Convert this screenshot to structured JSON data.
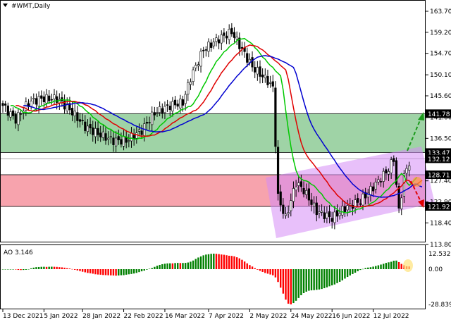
{
  "title": "#WMT,Daily",
  "indicator_label": "AO 3.146",
  "price_axis": [
    "163.70",
    "159.20",
    "154.70",
    "150.10",
    "145.60",
    "141.00",
    "136.50",
    "127.40",
    "122.90",
    "118.40",
    "113.80"
  ],
  "price_axis_values": [
    163.7,
    159.2,
    154.7,
    150.1,
    145.6,
    141.0,
    136.5,
    127.4,
    122.9,
    118.4,
    113.8
  ],
  "level_labels": [
    {
      "text": "141.78",
      "value": 141.78
    },
    {
      "text": "133.47",
      "value": 133.47
    },
    {
      "text": "132.12",
      "value": 132.12
    },
    {
      "text": "128.71",
      "value": 128.71
    },
    {
      "text": "121.92",
      "value": 121.92
    }
  ],
  "ao_axis": {
    "max_label": "12.532",
    "zero_label": "0.00",
    "min_label": "-28.839",
    "max": 12.532,
    "min": -28.839
  },
  "x_axis": [
    {
      "text": "13 Dec 2021",
      "bar": 0
    },
    {
      "text": "5 Jan 2022",
      "bar": 16
    },
    {
      "text": "28 Jan 2022",
      "bar": 31
    },
    {
      "text": "22 Feb 2022",
      "bar": 47
    },
    {
      "text": "16 Mar 2022",
      "bar": 63
    },
    {
      "text": "7 Apr 2022",
      "bar": 80
    },
    {
      "text": "2 May 2022",
      "bar": 96
    },
    {
      "text": "24 May 2022",
      "bar": 112
    },
    {
      "text": "16 Jun 2022",
      "bar": 128
    },
    {
      "text": "12 Jul 2022",
      "bar": 144
    }
  ],
  "colors": {
    "support_zone": "#9fd3a6",
    "resistance_zone": "#f7a3ad",
    "channel": "#d58cf5",
    "ma_fast": "#00c800",
    "ma_mid": "#e00000",
    "ma_slow": "#0000d0",
    "ao_up": "#008000",
    "ao_down": "#ff0000"
  },
  "chart_data": {
    "type": "candlestick",
    "symbol": "#WMT",
    "timeframe": "Daily",
    "ylim": [
      113.8,
      163.7
    ],
    "bars": 159,
    "close_anchors": [
      [
        0,
        143.5
      ],
      [
        5,
        140.5
      ],
      [
        10,
        144.2
      ],
      [
        15,
        145
      ],
      [
        21,
        145
      ],
      [
        26,
        142.7
      ],
      [
        32,
        139
      ],
      [
        37,
        137.5
      ],
      [
        43,
        136
      ],
      [
        48,
        136
      ],
      [
        54,
        138.2
      ],
      [
        59,
        142
      ],
      [
        65,
        143.5
      ],
      [
        70,
        144.2
      ],
      [
        73,
        149.5
      ],
      [
        78,
        155.5
      ],
      [
        84,
        157.8
      ],
      [
        89,
        159.3
      ],
      [
        93,
        155.5
      ],
      [
        97,
        151.8
      ],
      [
        103,
        148.8
      ],
      [
        105,
        147.3
      ],
      [
        107,
        123.9
      ],
      [
        110,
        119.4
      ],
      [
        114,
        127
      ],
      [
        117,
        125.4
      ],
      [
        122,
        120.9
      ],
      [
        128,
        119.4
      ],
      [
        133,
        121.6
      ],
      [
        139,
        123.1
      ],
      [
        144,
        126.1
      ],
      [
        150,
        129.9
      ],
      [
        152,
        132.2
      ],
      [
        154,
        120.9
      ],
      [
        156,
        128.4
      ],
      [
        158,
        131.4
      ]
    ],
    "levels": {
      "resistance_top": 141.78,
      "resistance_bottom": 133.47,
      "gray_line": 132.12,
      "red_top": 128.71,
      "red_bottom": 121.92
    },
    "ao_last": 3.146
  }
}
